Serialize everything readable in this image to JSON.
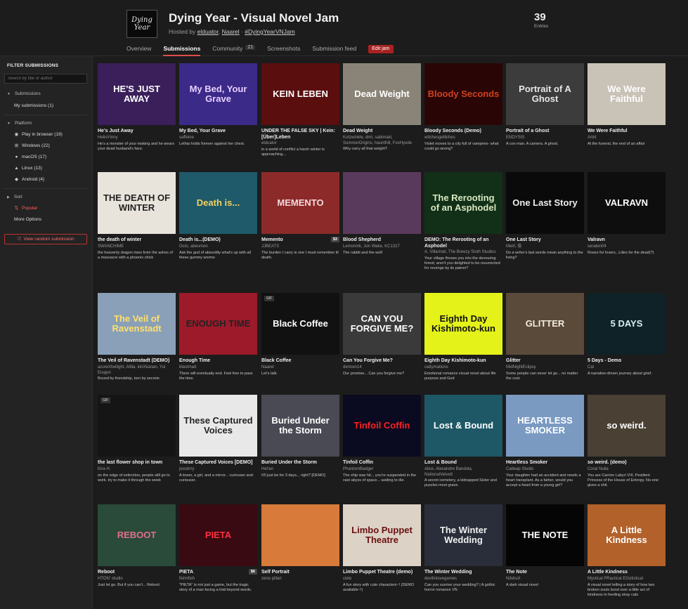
{
  "jam": {
    "logo_line1": "Dying",
    "logo_line2": "Year",
    "title": "Dying Year - Visual Novel Jam",
    "hosted_prefix": "Hosted by ",
    "host1": "elduator",
    "host2": "Naarel",
    "hashtag": "#DyingYearVNJam",
    "entries_count": "39",
    "entries_label": "Entries"
  },
  "tabs": [
    {
      "label": "Overview"
    },
    {
      "label": "Submissions",
      "active": true
    },
    {
      "label": "Community",
      "count": "21"
    },
    {
      "label": "Screenshots"
    },
    {
      "label": "Submission feed"
    }
  ],
  "edit_jam_label": "Edit jam",
  "sidebar": {
    "heading": "FILTER SUBMISSIONS",
    "search_placeholder": "Search by title or author",
    "submissions_section": "Submissions",
    "my_submissions": "My submissions (1)",
    "platform_section": "Platform",
    "platforms": [
      {
        "label": "Play in browser (19)",
        "icon": "globe-icon"
      },
      {
        "label": "Windows (22)",
        "icon": "windows-icon"
      },
      {
        "label": "macOS (17)",
        "icon": "apple-icon"
      },
      {
        "label": "Linux (13)",
        "icon": "linux-icon"
      },
      {
        "label": "Android (4)",
        "icon": "android-icon"
      }
    ],
    "sort_section": "Sort",
    "sort_popular": "Popular",
    "more_options": "More Options",
    "random_button": "View random submission"
  },
  "entries": [
    {
      "title": "He's Just Away",
      "author": "HelioYinny",
      "desc": "He's a monster of your making and he wears your dead husband's face.",
      "thumb_text": "HE'S JUST AWAY",
      "bg": "#3a1f5a",
      "fg": "#ffffff"
    },
    {
      "title": "My Bed, Your Grave",
      "author": "saffeine",
      "desc": "Lethia holds forever against her chest.",
      "thumb_text": "My Bed, Your Grave",
      "bg": "#3b2a88",
      "fg": "#e8d0ff"
    },
    {
      "title": "UNDER THE FALSE SKY | Kein: [Über]Leben",
      "author": "elduator",
      "desc": "in a world of conflict a harsh winter is approaching...",
      "thumb_text": "KEIN LEBEN",
      "bg": "#5a0e0e",
      "fg": "#ffffff"
    },
    {
      "title": "Dead Weight",
      "author": "Kotzwinkle, dmt, sabimaki, SummerOrigins, haunthill, FoxHyode",
      "desc": "Why carry all that weight?",
      "thumb_text": "Dead Weight",
      "bg": "#8a8478",
      "fg": "#ffffff"
    },
    {
      "title": "Bloody Seconds (Demo)",
      "author": "witchesgetliches",
      "desc": "Violet moves to a city full of vampires- what could go wrong?",
      "thumb_text": "Bloody Seconds",
      "bg": "#2a0505",
      "fg": "#d04020"
    },
    {
      "title": "Portrait of a Ghost",
      "author": "ENDYSIS",
      "desc": "A con man. A camera. A ghost.",
      "thumb_text": "Portrait of A Ghost",
      "bg": "#3c3c3c",
      "fg": "#e8e8e8"
    },
    {
      "title": "We Were Faithful",
      "author": "Arbit",
      "desc": "At the funeral, the end of an affair",
      "thumb_text": "We Were Faithful",
      "bg": "#c9c2b6",
      "fg": "#ffffff"
    },
    {
      "title": "the death of winter",
      "author": "SWANCHIME",
      "desc": "the heavenly dragon rises from the ashes of a massacre with a phoenix chick",
      "thumb_text": "THE DEATH OF WINTER",
      "bg": "#e8e4dc",
      "fg": "#222222"
    },
    {
      "title": "Death is...(DEMO)",
      "author": "Octo, abesmon",
      "desc": "Ask the god of absurdity what's up with all these gummy worms",
      "thumb_text": "Death is...",
      "bg": "#1e5a6a",
      "fg": "#f5d060"
    },
    {
      "title": "Memento",
      "author": "JJBEATS",
      "desc": "The burden I carry is one I must remember til death.",
      "thumb_text": "MEMENTO",
      "bg": "#8c2a2a",
      "fg": "#f3d9d9",
      "price": "$3"
    },
    {
      "title": "Blood Shepherd",
      "author": "Lemonink, Jon Wake, KC1327",
      "desc": "The rabbit and the wolf",
      "thumb_text": "",
      "bg": "#5a3a5c",
      "fg": "#ffffff"
    },
    {
      "title": "DEMO: The Rerooting of an Asphodel",
      "author": "A. Villarroel, The Breezy Sloth Studios",
      "desc": "Your village throws you into the devouring forest; aren't you delighted to be resurrected for revenge by its patron?",
      "thumb_text": "The Rerooting of an Asphodel",
      "bg": "#123018",
      "fg": "#d8e8c0"
    },
    {
      "title": "One Last Story",
      "author": "Melrl, 俊",
      "desc": "Do a writer's last words mean anything to the living?",
      "thumb_text": "One Last Story",
      "bg": "#0a0a0a",
      "fg": "#eeeeee"
    },
    {
      "title": "Valravn",
      "author": "seraten04",
      "desc": "Roses for lovers...Lilies for the dead(?)",
      "thumb_text": "VALRAVN",
      "bg": "#0e0e0e",
      "fg": "#ffffff"
    },
    {
      "title": "The Veil of Ravenstadt (DEMO)",
      "author": "azureXtwilight, Altila, kiriXkanan, Yui Enajori",
      "desc": "Bound by friendship, torn by secrets",
      "thumb_text": "The Veil of Ravenstadt",
      "bg": "#8aa0b8",
      "fg": "#ffe06a"
    },
    {
      "title": "Enough Time",
      "author": "blastmatt",
      "desc": "There will eventually end. Feel free to pass the time.",
      "thumb_text": "ENOUGH TIME",
      "bg": "#9c1a2a",
      "fg": "#222222"
    },
    {
      "title": "Black Coffee",
      "author": "Naarel",
      "desc": "Let's talk.",
      "thumb_text": "Black Coffee",
      "bg": "#111111",
      "fg": "#ffffff",
      "gif": true
    },
    {
      "title": "Can You Forgive Me?",
      "author": "dennen14",
      "desc": "Our promise... Can you forgive me?",
      "thumb_text": "CAN YOU FORGIVE ME?",
      "bg": "#3a3a3a",
      "fg": "#ffffff"
    },
    {
      "title": "Eighth Day Kishimoto-kun",
      "author": "cattymations",
      "desc": "Emotional romance visual novel about life purpose and God",
      "thumb_text": "Eighth Day Kishimoto-kun",
      "bg": "#e4f21a",
      "fg": "#111111"
    },
    {
      "title": "Glitter",
      "author": "MidNightEclipsy",
      "desc": "Some people can never let go... no matter the cost.",
      "thumb_text": "GLITTER",
      "bg": "#5a4a3a",
      "fg": "#f3ece0"
    },
    {
      "title": "5 Days - Demo",
      "author": "Cal",
      "desc": "A narrative-driven journey about grief.",
      "thumb_text": "5 DAYS",
      "bg": "#0e2228",
      "fg": "#d8eef0"
    },
    {
      "title": "the last flower shop in town",
      "author": "Kira H.",
      "desc": "on the edge of extinction, people still go to work. try to make it through the week",
      "thumb_text": "",
      "bg": "#151515",
      "fg": "#ffffff",
      "gif": true
    },
    {
      "title": "These Captured Voices [DEMO]",
      "author": "joosbrry",
      "desc": "A tower, a girl, and a mirror... curiouser and curiouser.",
      "thumb_text": "These Captured Voices",
      "bg": "#e8e8e8",
      "fg": "#222222"
    },
    {
      "title": "Buried Under the Storm",
      "author": "Hel'an",
      "desc": "It'll just be for 3 days... right? [DEMO]",
      "thumb_text": "Buried Under the Storm",
      "bg": "#4a4a55",
      "fg": "#ffffff"
    },
    {
      "title": "Tinfoil Coffin",
      "author": "PhantomBadger",
      "desc": "The ship was hit... you're suspended in the vast abyss of space... waiting to die.",
      "thumb_text": "Tinfoil Coffin",
      "bg": "#0a0a20",
      "fg": "#ff2020"
    },
    {
      "title": "Lost & Bound",
      "author": "Alice, Alexandre Bandola, NationalVelvett",
      "desc": "A secret cemetery, a kidnapped Sister and puzzles most grave.",
      "thumb_text": "Lost & Bound",
      "bg": "#1e5866",
      "fg": "#ffffff"
    },
    {
      "title": "Heartless Smoker",
      "author": "Catleap Studio",
      "desc": "Your daughter had an accident and needs a heart transplant. As a father, would you accept a heart from a young girl?",
      "thumb_text": "HEARTLESS SMOKER",
      "bg": "#7a9ac2",
      "fg": "#ffffff"
    },
    {
      "title": "so weird. (demo)",
      "author": "Coral Nulla",
      "desc": "You are Carrion Labyri VIII, Pestilent Princess of the House of Entropy. No-one gives a shit.",
      "thumb_text": "so weird.",
      "bg": "#4a4034",
      "fg": "#ffffff"
    },
    {
      "title": "Reboot",
      "author": "HTON' studio",
      "desc": "Just let go. But if you can't... Reboot",
      "thumb_text": "REBOOT",
      "bg": "#2a4a3a",
      "fg": "#e0708a"
    },
    {
      "title": "PIETA",
      "author": "fishnfish",
      "desc": "\"PIETA\" is not just a game, but the tragic story of a man facing a trial beyond words.",
      "thumb_text": "PIETA",
      "bg": "#3a0a12",
      "fg": "#ff3040",
      "price": "$6"
    },
    {
      "title": "Self Portrait",
      "author": "zeno pillan",
      "desc": "",
      "thumb_text": "",
      "bg": "#d87a3a",
      "fg": "#ffffff"
    },
    {
      "title": "Limbo Puppet Theatre (demo)",
      "author": "cielo",
      "desc": "A fun story with cute characters~! (DEMO available~!)",
      "thumb_text": "Limbo Puppet Theatre",
      "bg": "#dcd2c6",
      "fg": "#6a1010"
    },
    {
      "title": "The Winter Wedding",
      "author": "devilinlovegames",
      "desc": "Can you survive your wedding? | A gothic horror romance VN",
      "thumb_text": "The Winter Wedding",
      "bg": "#2a2e3a",
      "fg": "#f0f0f0"
    },
    {
      "title": "The Note",
      "author": "NilshuX",
      "desc": "A dark visual novel",
      "thumb_text": "THE NOTE",
      "bg": "#050505",
      "fg": "#ffffff"
    },
    {
      "title": "A Little Kindness",
      "author": "Mystical PRactical EGotistical",
      "desc": "A visual novel telling a story of how two broken souls bond over a little act of kindness in feeding stray cats",
      "thumb_text": "A Little Kindness",
      "bg": "#b2612a",
      "fg": "#ffffff"
    }
  ]
}
